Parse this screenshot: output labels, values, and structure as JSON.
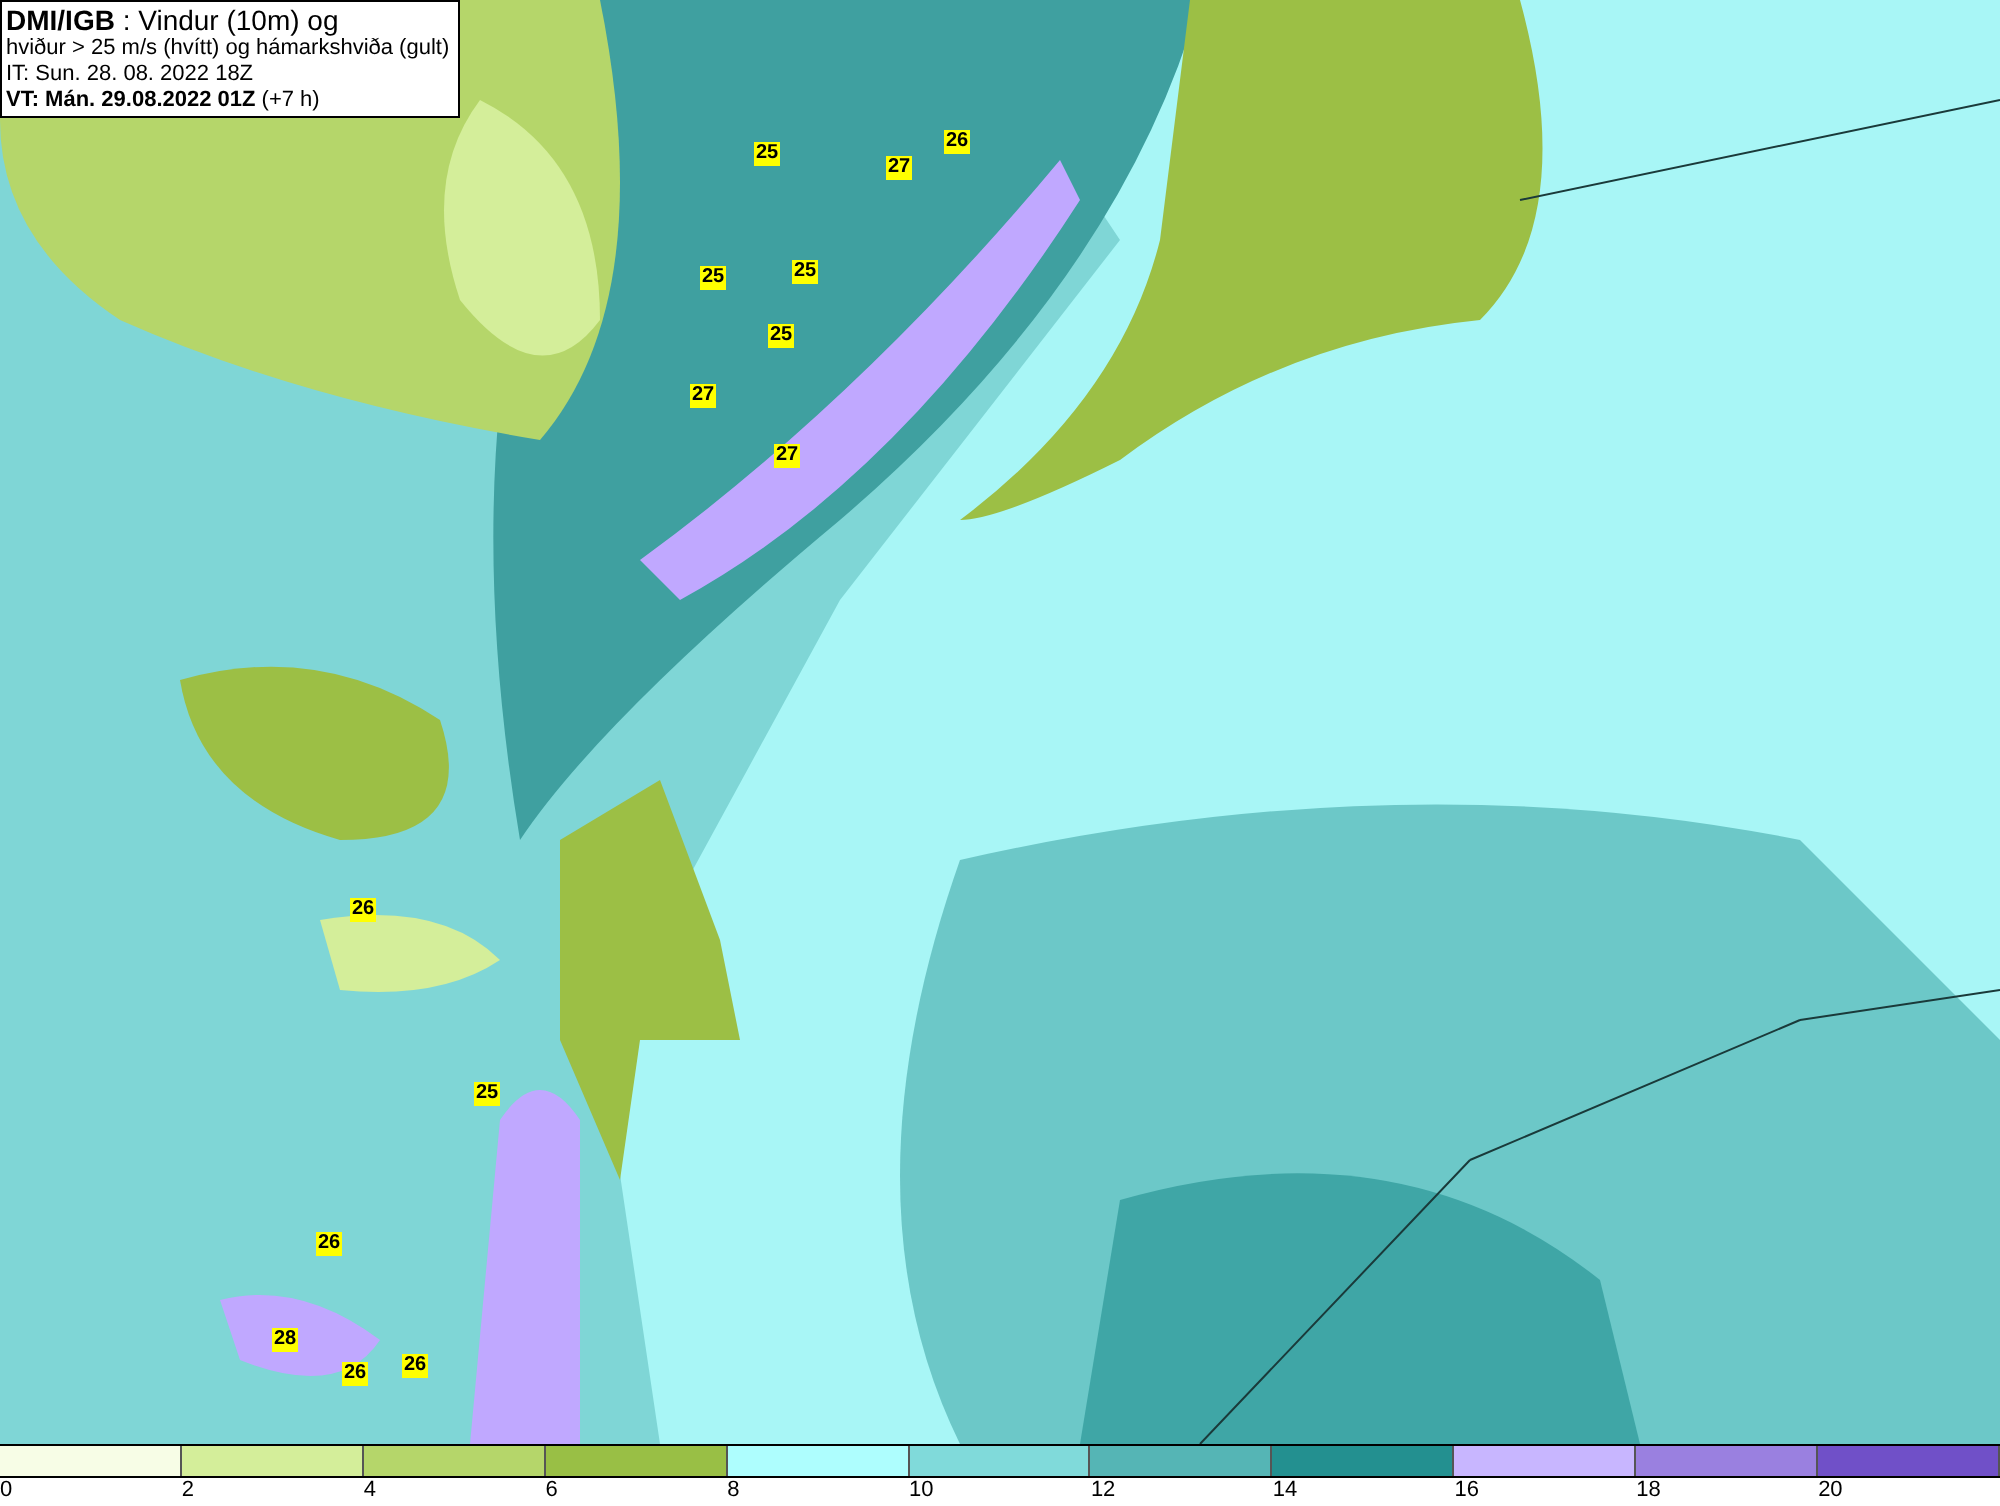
{
  "header": {
    "lines": [
      "**DMI/IGB** : Vindur (10m) og",
      "hviður > 25 m/s (hvítt) og hámarkshviða (gult)",
      "IT: Sun. 28. 08. 2022 18Z",
      "**VT: Mán. 29.08.2022 01Z** (+7 h)"
    ]
  },
  "map": {
    "gust_labels": [
      "25",
      "27",
      "26",
      "25",
      "25",
      "25",
      "27",
      "27",
      "26",
      "25",
      "26",
      "28",
      "26",
      "26"
    ]
  },
  "colorbar": {
    "segments": [
      {
        "color": "#f7fde6"
      },
      {
        "color": "#d4ee9a"
      },
      {
        "color": "#b5d66a"
      },
      {
        "color": "#99bf45"
      },
      {
        "color": "#aefefe"
      },
      {
        "color": "#80dada"
      },
      {
        "color": "#55b5b5"
      },
      {
        "color": "#239090"
      },
      {
        "color": "#c8b6ff"
      },
      {
        "color": "#9a80e0"
      },
      {
        "color": "#7050c8"
      }
    ],
    "ticks": [
      "0",
      "2",
      "4",
      "6",
      "8",
      "10",
      "12",
      "14",
      "16",
      "18",
      "20"
    ]
  }
}
